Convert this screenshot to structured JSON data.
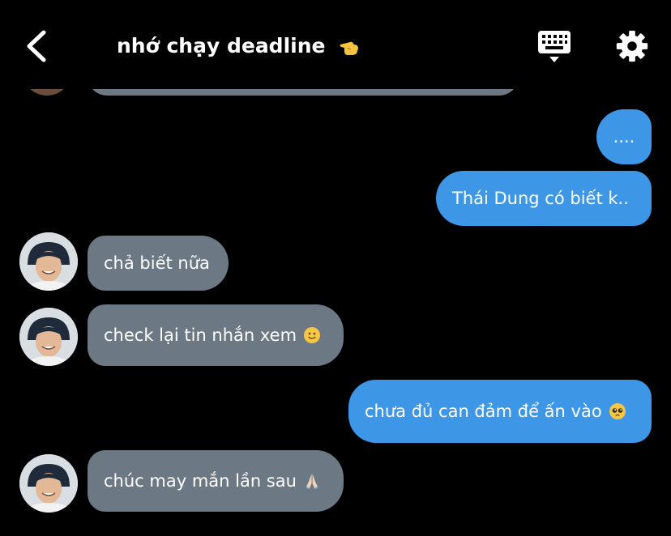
{
  "header": {
    "title": "nhớ chạy deadline",
    "title_emoji": "pointing-hand-emoji",
    "back_icon": "chevron-left-icon",
    "keyboard_icon": "keyboard-icon",
    "settings_icon": "gear-icon"
  },
  "messages": [
    {
      "side": "outgoing",
      "text": "...."
    },
    {
      "side": "outgoing",
      "text": "Thái Dung có biết k.."
    },
    {
      "side": "incoming",
      "text": "chả biết nữa"
    },
    {
      "side": "incoming",
      "text": "check lại tin nhắn xem",
      "emoji": "slightly-smiling-face-emoji"
    },
    {
      "side": "outgoing",
      "text": "chưa đủ can đảm để ấn vào",
      "emoji": "pleading-face-emoji"
    },
    {
      "side": "incoming",
      "text": "chúc may mắn lần sau",
      "emoji": "folded-hands-emoji"
    }
  ],
  "colors": {
    "background": "#000000",
    "incoming_bubble": "#6d7885",
    "outgoing_bubble": "#3d97e6",
    "text": "#ffffff"
  }
}
